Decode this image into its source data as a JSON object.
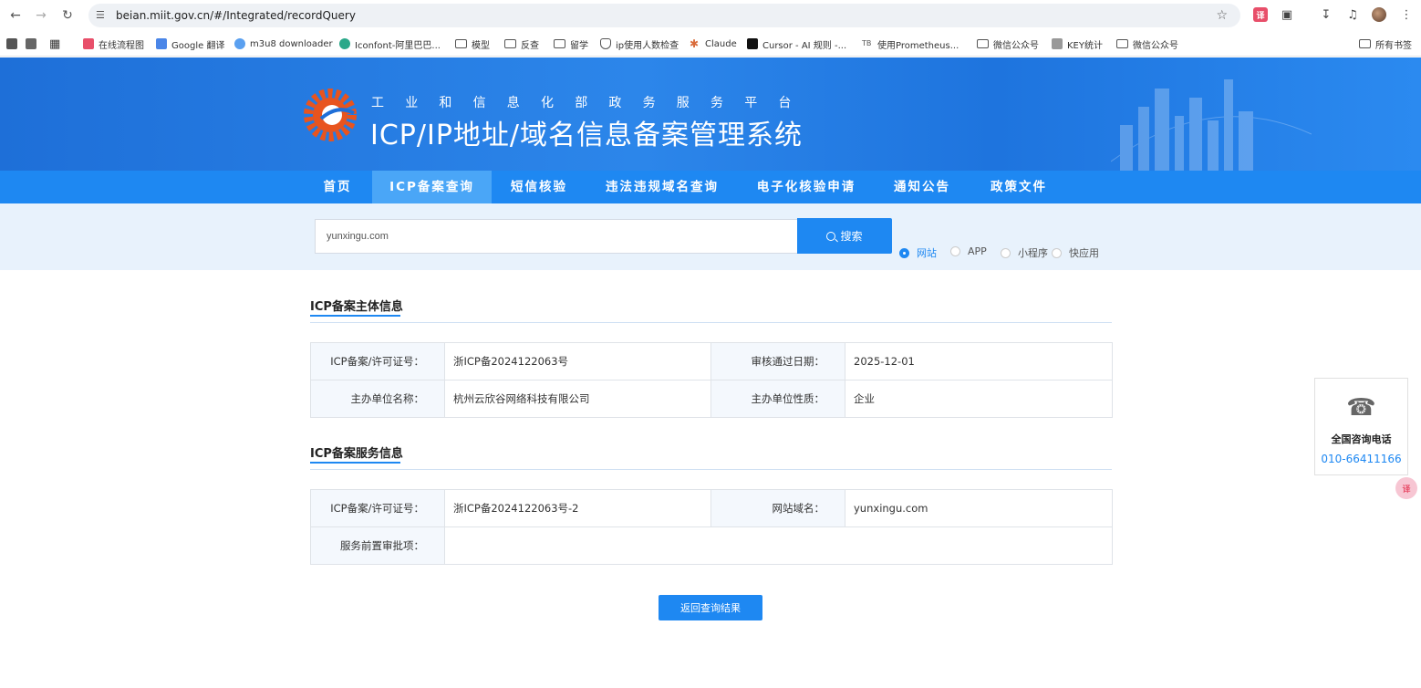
{
  "browser": {
    "url": "beian.miit.gov.cn/#/Integrated/recordQuery",
    "bookmarks": [
      {
        "label": "在线流程图",
        "icon": "red-square-icon"
      },
      {
        "label": "Google 翻译",
        "icon": "google-translate-icon"
      },
      {
        "label": "m3u8 downloader",
        "icon": "rocket-icon"
      },
      {
        "label": "Iconfont-阿里巴巴...",
        "icon": "iconfont-icon"
      },
      {
        "label": "模型",
        "icon": "folder-icon"
      },
      {
        "label": "反查",
        "icon": "folder-icon"
      },
      {
        "label": "留学",
        "icon": "folder-icon"
      },
      {
        "label": "ip使用人数检查",
        "icon": "shield-icon"
      },
      {
        "label": "Claude",
        "icon": "claude-icon"
      },
      {
        "label": "Cursor - AI 规则 -...",
        "icon": "cursor-icon"
      },
      {
        "label": "使用Prometheus...",
        "icon": "tb-icon"
      },
      {
        "label": "微信公众号",
        "icon": "folder-icon"
      },
      {
        "label": "KEY统计",
        "icon": "key-icon"
      },
      {
        "label": "微信公众号",
        "icon": "folder-icon"
      }
    ],
    "all_bookmarks": "所有书签"
  },
  "header": {
    "subtitle": "工业和信息化部政务服务平台",
    "title": "ICP/IP地址/域名信息备案管理系统"
  },
  "menu": {
    "items": [
      "首页",
      "ICP备案查询",
      "短信核验",
      "违法违规域名查询",
      "电子化核验申请",
      "通知公告",
      "政策文件"
    ],
    "active_index": 1
  },
  "search": {
    "value": "yunxingu.com",
    "button_label": "搜索",
    "types": [
      "网站",
      "APP",
      "小程序",
      "快应用"
    ],
    "selected_type": "网站"
  },
  "subject_section": {
    "title": "ICP备案主体信息",
    "rows": [
      {
        "k1": "ICP备案/许可证号：",
        "v1": "浙ICP备2024122063号",
        "k2": "审核通过日期：",
        "v2": "2025-12-01"
      },
      {
        "k1": "主办单位名称：",
        "v1": "杭州云欣谷网络科技有限公司",
        "k2": "主办单位性质：",
        "v2": "企业"
      }
    ]
  },
  "service_section": {
    "title": "ICP备案服务信息",
    "row1": {
      "k1": "ICP备案/许可证号：",
      "v1": "浙ICP备2024122063号-2",
      "k2": "网站域名：",
      "v2": "yunxingu.com"
    },
    "row2": {
      "k": "服务前置审批项：",
      "v": ""
    }
  },
  "back_button": "返回查询结果",
  "hotline": {
    "label": "全国咨询电话",
    "number": "010-66411166"
  },
  "colors": {
    "primary": "#1e88f2",
    "banner": "#2c86ea",
    "band": "#e8f2fc"
  }
}
